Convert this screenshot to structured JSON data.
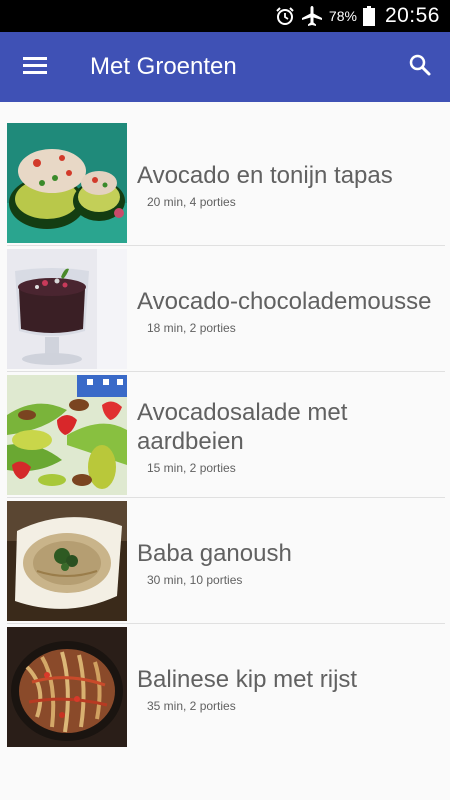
{
  "status_bar": {
    "battery_percent": "78%",
    "time": "20:56",
    "icons": [
      "alarm-icon",
      "airplane-icon",
      "battery-icon"
    ]
  },
  "app_bar": {
    "title": "Met Groenten",
    "menu_icon": "hamburger-menu-icon",
    "search_icon": "search-icon",
    "color": "#3f51b5"
  },
  "recipes": [
    {
      "name": "Avocado en tonijn tapas",
      "meta": "20 min, 4 porties"
    },
    {
      "name": "Avocado-chocolademousse",
      "meta": "18 min, 2 porties"
    },
    {
      "name": "Avocadosalade met aardbeien",
      "meta": "15 min, 2 porties"
    },
    {
      "name": "Baba ganoush",
      "meta": "30 min, 10 porties"
    },
    {
      "name": "Balinese kip met rijst",
      "meta": "35 min, 2 porties"
    }
  ]
}
